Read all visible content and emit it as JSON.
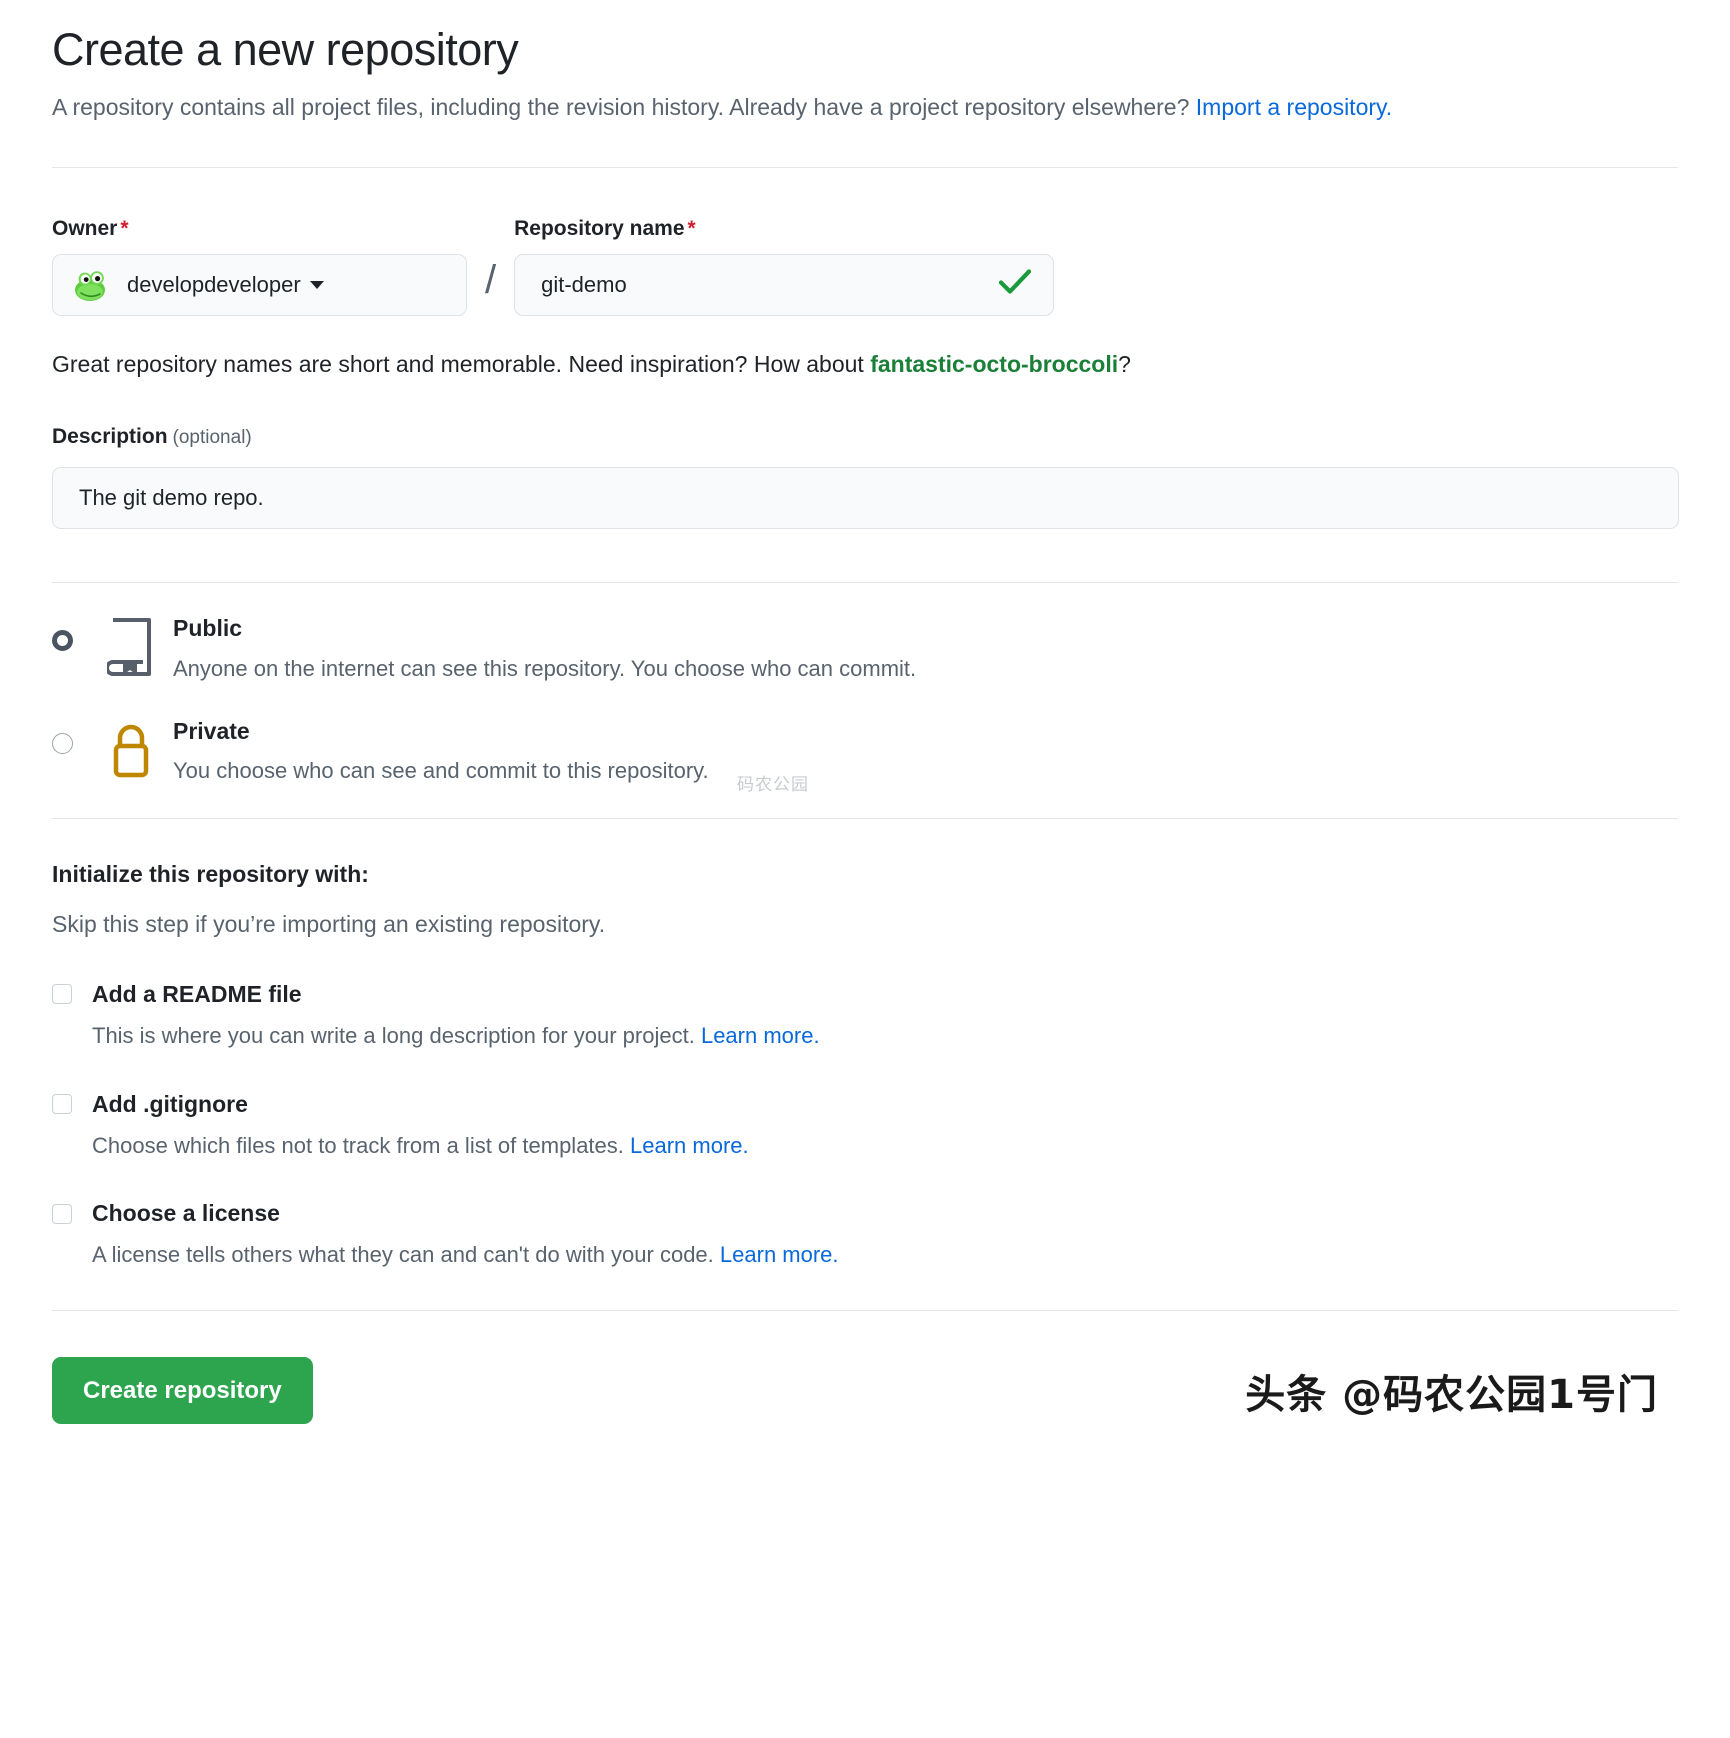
{
  "header": {
    "title": "Create a new repository",
    "subtitle_before": "A repository contains all project files, including the revision history. Already have a project repository elsewhere? ",
    "import_link": "Import a repository."
  },
  "owner": {
    "label": "Owner",
    "required_mark": "*",
    "name": "developdeveloper",
    "avatar_icon": "frog-avatar"
  },
  "repo_name": {
    "label": "Repository name",
    "required_mark": "*",
    "value": "git-demo",
    "placeholder": "",
    "separator": "/",
    "valid_icon": "check-icon"
  },
  "hint": {
    "before": "Great repository names are short and memorable. Need inspiration? How about ",
    "suggestion": "fantastic-octo-broccoli",
    "after": "?"
  },
  "description": {
    "label": "Description",
    "optional": "(optional)",
    "value": "The git demo repo.",
    "placeholder": ""
  },
  "visibility": {
    "selected": "public",
    "options": [
      {
        "id": "public",
        "title": "Public",
        "desc": "Anyone on the internet can see this repository. You choose who can commit.",
        "icon": "repo-book-icon",
        "checked": true
      },
      {
        "id": "private",
        "title": "Private",
        "desc": "You choose who can see and commit to this repository.",
        "icon": "lock-icon",
        "checked": false
      }
    ]
  },
  "initialize": {
    "title": "Initialize this repository with:",
    "subtitle": "Skip this step if you’re importing an existing repository.",
    "options": [
      {
        "title": "Add a README file",
        "desc": "This is where you can write a long description for your project. ",
        "link": "Learn more.",
        "checked": false
      },
      {
        "title": "Add .gitignore",
        "desc": "Choose which files not to track from a list of templates. ",
        "link": "Learn more.",
        "checked": false
      },
      {
        "title": "Choose a license",
        "desc": "A license tells others what they can and can't do with your code. ",
        "link": "Learn more.",
        "checked": false
      }
    ]
  },
  "footer": {
    "create_button": "Create repository",
    "watermark": "头条 @码农公园1号门",
    "inline_watermark": "码农公园"
  },
  "colors": {
    "accent_green": "#2da44e",
    "link_blue": "#0969da",
    "suggest_green": "#1a7f37",
    "required_red": "#cf222e",
    "lock_gold": "#bf8700",
    "muted_text": "#59636e"
  }
}
